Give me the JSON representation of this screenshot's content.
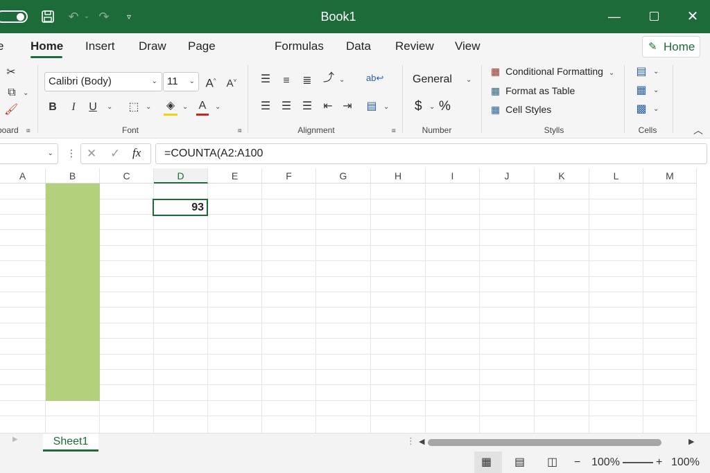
{
  "app": {
    "title": "Book1"
  },
  "tabs": [
    {
      "label": "e"
    },
    {
      "label": "Home"
    },
    {
      "label": "Insert"
    },
    {
      "label": "Draw"
    },
    {
      "label": "Page Layout"
    },
    {
      "label": "Formulas"
    },
    {
      "label": "Data"
    },
    {
      "label": "Review"
    },
    {
      "label": "View"
    }
  ],
  "home_button": {
    "label": "Home"
  },
  "ribbon": {
    "clipboard_label": "board",
    "font": {
      "name": "Calibri (Body)",
      "size": "11",
      "group_label": "Font"
    },
    "alignment": {
      "group_label": "Alignment"
    },
    "number": {
      "format": "General",
      "currency": "$",
      "percent": "%",
      "group_label": "Number"
    },
    "styles": {
      "conditional": "Conditional Formatting",
      "table": "Format as Table",
      "cell_styles": "Cell Styles",
      "group_label": "Stylls"
    },
    "cells": {
      "group_label": "Cells"
    }
  },
  "formula_bar": {
    "fx": "fx",
    "formula": "=COUNTA(A2:A100"
  },
  "grid": {
    "columns": [
      "A",
      "B",
      "C",
      "D",
      "E",
      "F",
      "G",
      "H",
      "I",
      "J",
      "K",
      "L",
      "M"
    ],
    "active_cell_value": "93",
    "fill_color": "#b3d17d"
  },
  "sheets": [
    {
      "name": "Sheet1"
    }
  ],
  "status": {
    "zoom": "100%",
    "zoom2": "100%",
    "minus": "−",
    "plus": "+"
  },
  "colors": {
    "accent": "#1e6b3a"
  }
}
